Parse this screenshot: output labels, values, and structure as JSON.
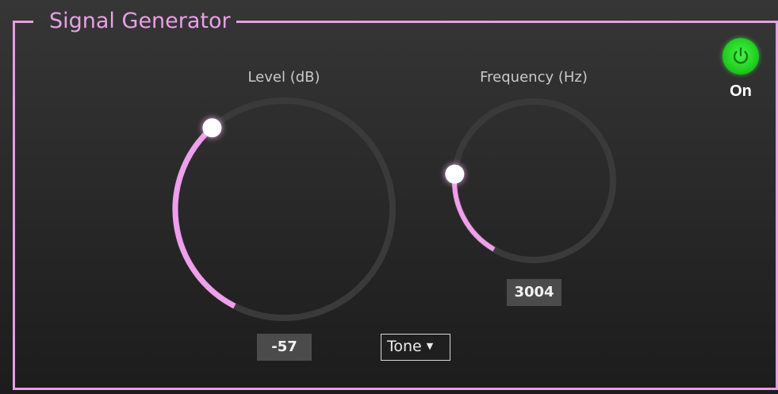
{
  "panel": {
    "title": "Signal Generator",
    "accent_color": "#e59ee4"
  },
  "level": {
    "label": "Level (dB)",
    "value": "-57",
    "fill_fraction": 0.31
  },
  "frequency": {
    "label": "Frequency (Hz)",
    "value": "3004",
    "fill_fraction": 0.18
  },
  "waveform": {
    "selected": "Tone",
    "icon": "caret-down-icon"
  },
  "power": {
    "label": "On",
    "icon": "power-icon",
    "color": "#22d322"
  }
}
